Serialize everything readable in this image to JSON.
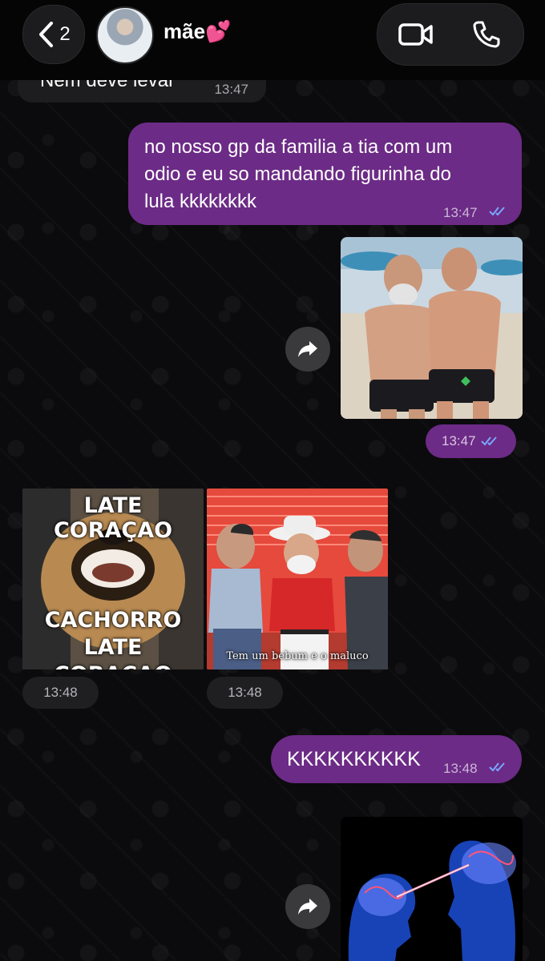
{
  "header": {
    "back_count": "2",
    "contact_name": "mãe💕"
  },
  "messages": [
    {
      "type": "text",
      "direction": "in",
      "text": "Nem deve levar",
      "time": "13:47"
    },
    {
      "type": "text",
      "direction": "out",
      "lines": [
        "no nosso gp da familia a tia com um",
        "odio e eu so mandando figurinha do",
        "lula kkkkkkkk"
      ],
      "time": "13:47",
      "status": "read"
    },
    {
      "type": "image",
      "direction": "out",
      "description": "beach-photo",
      "time": "13:47",
      "status": "read"
    },
    {
      "type": "sticker",
      "direction": "in",
      "caption_top": "LATE CORAÇAO",
      "caption_bottom": "CACHORRO LATE CORAÇAO",
      "time": "13:48"
    },
    {
      "type": "sticker",
      "direction": "in",
      "caption": "Tem um bebum e o maluco",
      "time": "13:48"
    },
    {
      "type": "text",
      "direction": "out",
      "text": "KKKKKKKKKK",
      "time": "13:48",
      "status": "read"
    },
    {
      "type": "image",
      "direction": "out",
      "description": "brains-image"
    }
  ],
  "colors": {
    "outgoing_bubble": "#6c2b86",
    "incoming_bubble": "#1d1d1f",
    "read_ticks": "#7aa7ff",
    "background": "#0b0b0d"
  },
  "icons": [
    "chevron-left-icon",
    "video-call-icon",
    "phone-icon",
    "forward-icon",
    "double-check-icon"
  ]
}
